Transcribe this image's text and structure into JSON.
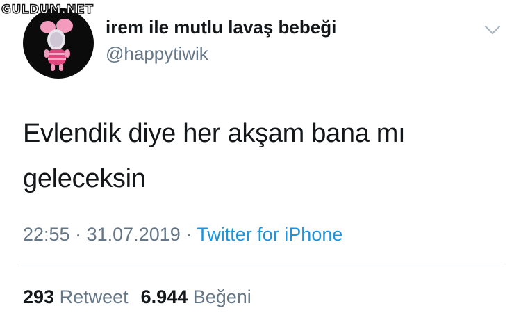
{
  "watermark": {
    "text": "GULDUM.NET"
  },
  "tweet": {
    "author": {
      "display_name": "irem ile mutlu lavaş bebeği",
      "handle": "@happytiwik",
      "avatar_icon": "piglet-avatar-icon"
    },
    "menu_icon": "chevron-down-icon",
    "text_line1": "Evlendik diye her akşam bana mı",
    "text_line2": "geleceksin",
    "time": "22:55",
    "separator": "·",
    "date": "31.07.2019",
    "source": "Twitter for iPhone",
    "stats": {
      "retweets_count": "293",
      "retweets_label": "Retweet",
      "likes_count": "6.944",
      "likes_label": "Beğeni"
    }
  },
  "colors": {
    "text": "#14171a",
    "secondary": "#657786",
    "link": "#1b95e0",
    "divider": "#d9dee2"
  }
}
